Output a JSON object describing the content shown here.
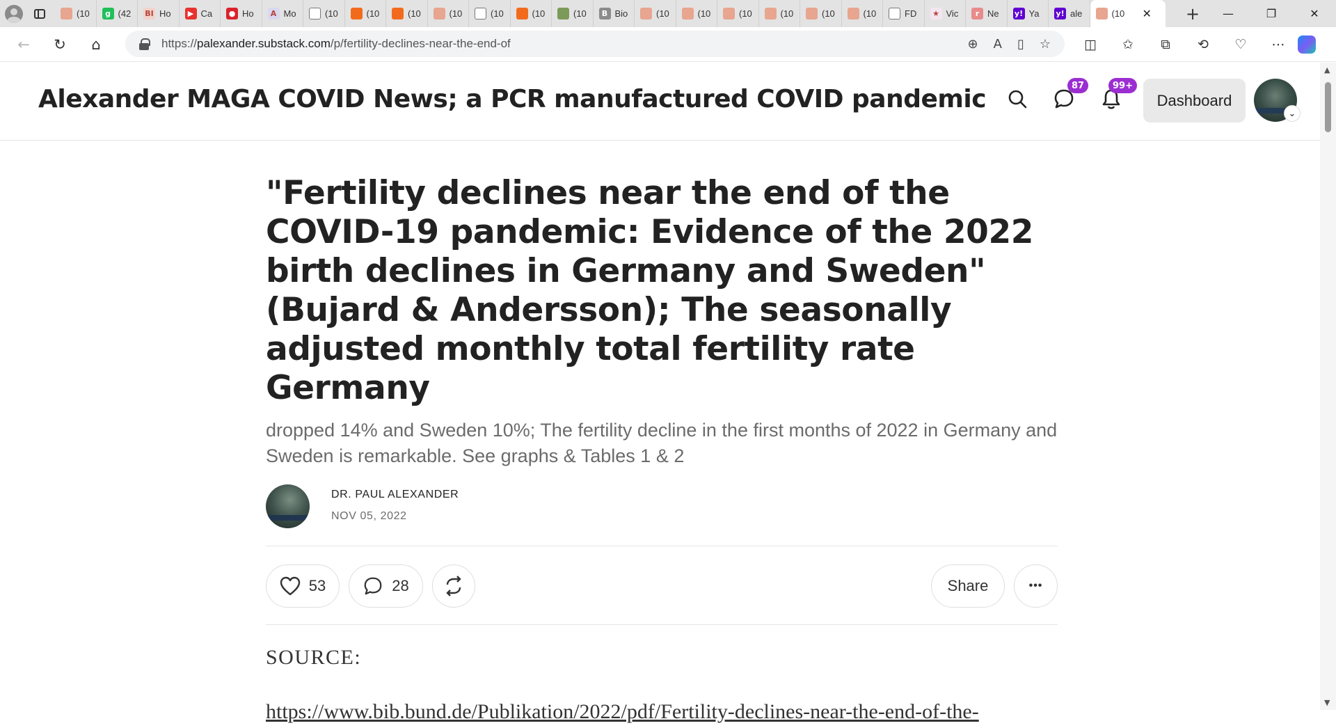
{
  "browser": {
    "tabs": [
      {
        "title": "(10",
        "fav_color": "#e8a58f",
        "fav_glyph": ""
      },
      {
        "title": "(42",
        "fav_color": "#1fbf5a",
        "fav_glyph": "g"
      },
      {
        "title": "Ho",
        "fav_color": "#f3d3cc",
        "fav_glyph": "BI"
      },
      {
        "title": "Ca",
        "fav_color": "#e8322f",
        "fav_glyph": "▶"
      },
      {
        "title": "Ho",
        "fav_color": "#d9232d",
        "fav_glyph": "●"
      },
      {
        "title": "Mo",
        "fav_color": "#d8d8f0",
        "fav_glyph": "A"
      },
      {
        "title": "(10",
        "fav_color": "#ffffff",
        "fav_glyph": ""
      },
      {
        "title": "(10",
        "fav_color": "#f26b1d",
        "fav_glyph": ""
      },
      {
        "title": "(10",
        "fav_color": "#f26b1d",
        "fav_glyph": ""
      },
      {
        "title": "(10",
        "fav_color": "#e8a58f",
        "fav_glyph": ""
      },
      {
        "title": "(10",
        "fav_color": "#ffffff",
        "fav_glyph": ""
      },
      {
        "title": "(10",
        "fav_color": "#f26b1d",
        "fav_glyph": ""
      },
      {
        "title": "(10",
        "fav_color": "#7c9a5a",
        "fav_glyph": ""
      },
      {
        "title": "Bio",
        "fav_color": "#8b8b8b",
        "fav_glyph": "B"
      },
      {
        "title": "(10",
        "fav_color": "#e8a58f",
        "fav_glyph": ""
      },
      {
        "title": "(10",
        "fav_color": "#e8a58f",
        "fav_glyph": ""
      },
      {
        "title": "(10",
        "fav_color": "#e8a58f",
        "fav_glyph": ""
      },
      {
        "title": "(10",
        "fav_color": "#e8a58f",
        "fav_glyph": ""
      },
      {
        "title": "(10",
        "fav_color": "#e8a58f",
        "fav_glyph": ""
      },
      {
        "title": "(10",
        "fav_color": "#e8a58f",
        "fav_glyph": ""
      },
      {
        "title": "FD",
        "fav_color": "#ffffff",
        "fav_glyph": ""
      },
      {
        "title": "Vic",
        "fav_color": "#f3e6f0",
        "fav_glyph": "★"
      },
      {
        "title": "Ne",
        "fav_color": "#e88b8b",
        "fav_glyph": "r"
      },
      {
        "title": "Ya",
        "fav_color": "#5f01d1",
        "fav_glyph": "y!"
      },
      {
        "title": "ale",
        "fav_color": "#5f01d1",
        "fav_glyph": "y!"
      }
    ],
    "active_tab": {
      "title": "(10",
      "fav_color": "#e8a58f",
      "close_icon": "✕"
    },
    "new_tab_icon": "+",
    "window_controls": {
      "minimize": "—",
      "restore": "❐",
      "close": "✕"
    },
    "nav": {
      "back": "←",
      "reload": "↻",
      "home": "⌂"
    },
    "url": {
      "prefix": "https://",
      "host": "palexander.substack.com",
      "path": "/p/fertility-declines-near-the-end-of"
    },
    "url_icons": {
      "zoom": "⊕",
      "read_aloud": "A",
      "immersive": "▯",
      "favorite": "☆"
    },
    "toolbar": {
      "split": "◫",
      "favorites": "✩",
      "collections": "⧉",
      "history": "⟲",
      "performance": "♡",
      "more": "⋯"
    }
  },
  "header": {
    "publication_title": "Alexander MAGA COVID News; a PCR manufactured COVID pandemic",
    "chat_badge": "87",
    "notif_badge": "99+",
    "dashboard_label": "Dashboard",
    "caret": "⌄"
  },
  "post": {
    "title": "\"Fertility declines near the end of the COVID-19 pandemic: Evidence of the 2022 birth declines in Germany and Sweden\" (Bujard & Andersson); The seasonally adjusted monthly total fertility rate Germany",
    "subtitle": "dropped 14% and Sweden 10%; The fertility decline in the first months of 2022 in Germany and Sweden is remarkable. See graphs & Tables 1 & 2",
    "author": "DR. PAUL ALEXANDER",
    "date": "NOV 05, 2022",
    "like_count": "53",
    "comment_count": "28",
    "share_label": "Share",
    "more_label": "•••",
    "source_label": "SOURCE:",
    "source_link": "https://www.bib.bund.de/Publikation/2022/pdf/Fertility-declines-near-the-end-of-the-"
  },
  "scroll": {
    "up": "▲",
    "down": "▼"
  }
}
